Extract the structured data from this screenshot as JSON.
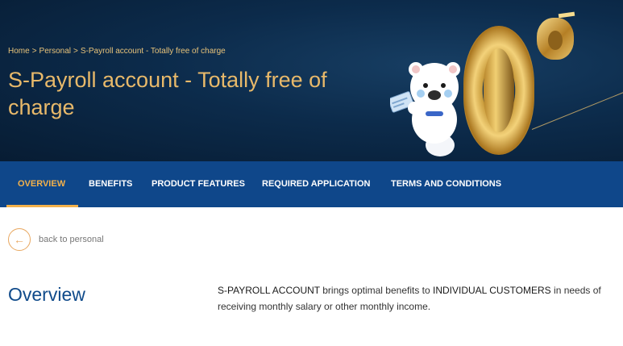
{
  "breadcrumb": {
    "items": [
      "Home",
      "Personal",
      "S-Payroll account - Totally free of charge"
    ],
    "separator": ">"
  },
  "hero": {
    "title": "S-Payroll account - Totally free of charge"
  },
  "tabs": [
    {
      "label": "OVERVIEW",
      "active": true
    },
    {
      "label": "BENEFITS",
      "active": false
    },
    {
      "label": "PRODUCT FEATURES",
      "active": false
    },
    {
      "label": "REQUIRED APPLICATION",
      "active": false
    },
    {
      "label": "TERMS AND CONDITIONS",
      "active": false
    }
  ],
  "back": {
    "icon": "arrow-left-icon",
    "label": "back to personal"
  },
  "overview": {
    "heading": "Overview",
    "parts": [
      "S-PAYROLL ACCOUNT",
      " brings optimal benefits to ",
      "INDIVIDUAL CUSTOMERS",
      " in needs of receiving monthly salary or other monthly income."
    ]
  },
  "colors": {
    "hero_bg": "#0c2b4b",
    "tab_bar": "#0f478a",
    "accent_gold": "#f3b14b",
    "heading_blue": "#0f4a8a"
  }
}
